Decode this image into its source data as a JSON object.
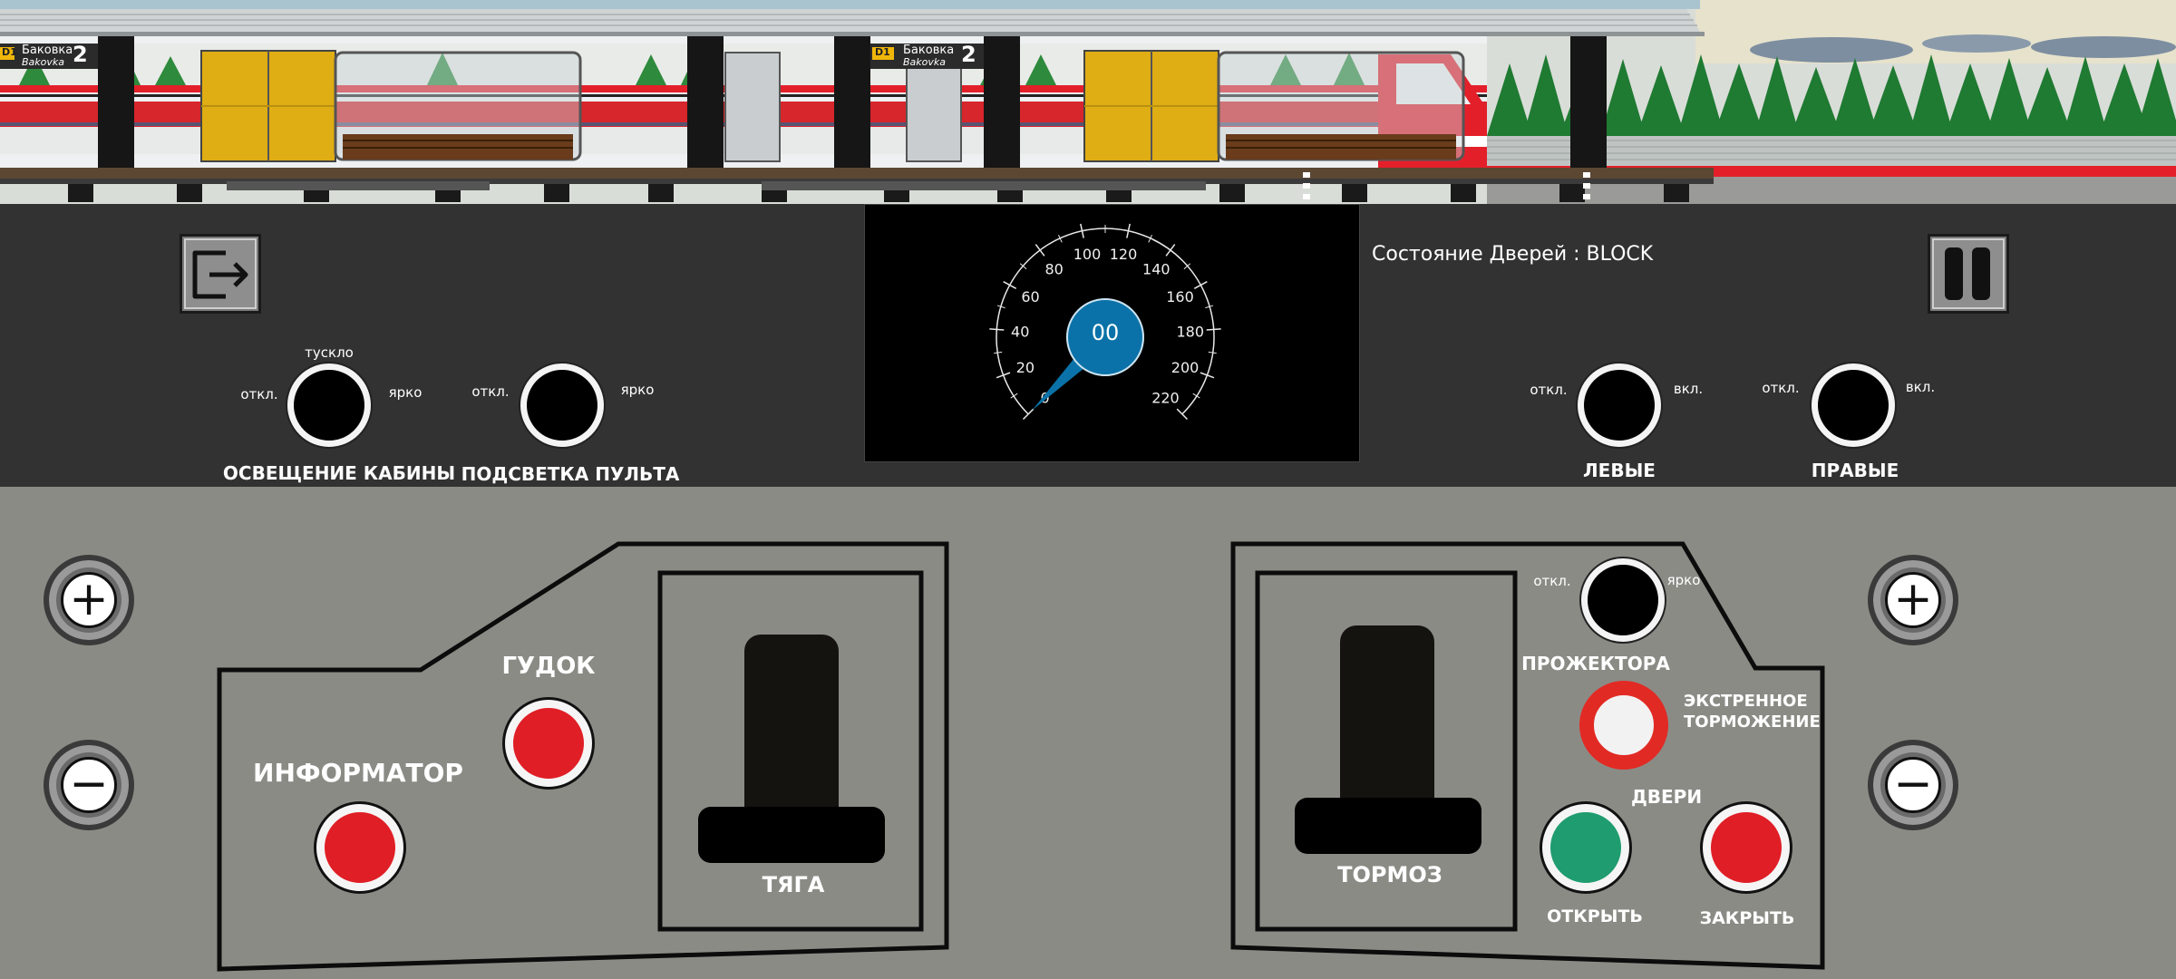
{
  "station": {
    "sign_code": "D1",
    "sign_text_ru": "Баковка",
    "sign_text_lat": "Bakovka",
    "sign_number": "2"
  },
  "speedometer": {
    "value_text": "00",
    "speed": 0,
    "max": 220,
    "ticks": [
      "0",
      "20",
      "40",
      "60",
      "80",
      "100",
      "120",
      "140",
      "160",
      "180",
      "200",
      "220"
    ],
    "accent_color": "#0a72a8"
  },
  "door_status": {
    "label": "Состояние Дверей : BLOCK"
  },
  "icons": {
    "exit": "exit-icon",
    "pause": "pause-icon"
  },
  "cabin_light": {
    "label": "ОСВЕЩЕНИЕ КАБИНЫ",
    "off": "откл.",
    "dim": "тускло",
    "bright": "ярко"
  },
  "console_light": {
    "label": "ПОДСВЕТКА ПУЛЬТА",
    "off": "откл.",
    "bright": "ярко"
  },
  "left_doors": {
    "label": "ЛЕВЫЕ",
    "off": "откл.",
    "on": "вкл."
  },
  "right_doors": {
    "label": "ПРАВЫЕ",
    "off": "откл.",
    "on": "вкл."
  },
  "controls": {
    "informer": "ИНФОРМАТОР",
    "horn": "ГУДОК",
    "traction": "ТЯГА",
    "brake": "ТОРМОЗ",
    "headlights": "ПРОЖЕКТОРА",
    "headlights_off": "откл.",
    "headlights_bright": "ярко",
    "emergency_line1": "ЭКСТРЕННОЕ",
    "emergency_line2": "ТОРМОЖЕНИЕ",
    "doors": "ДВЕРИ",
    "open": "ОТКРЫТЬ",
    "close": "ЗАКРЫТЬ"
  },
  "zoom": {
    "plus": "+",
    "minus": "−"
  },
  "colors": {
    "train_red": "#e3202a",
    "door_yellow": "#dfad14",
    "panel_dark": "#323232",
    "panel_gray": "#8b8b86"
  }
}
